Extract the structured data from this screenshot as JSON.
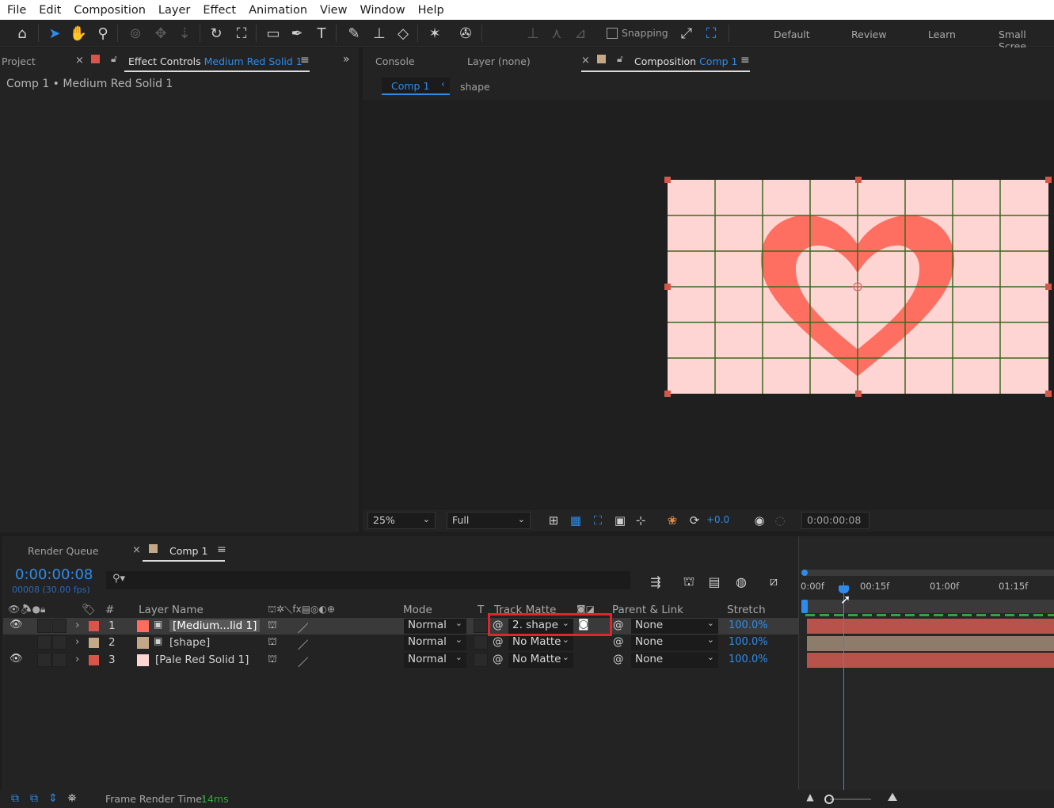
{
  "menu": [
    "File",
    "Edit",
    "Composition",
    "Layer",
    "Effect",
    "Animation",
    "View",
    "Window",
    "Help"
  ],
  "toolbar": {
    "snapping_label": "Snapping",
    "workspaces": [
      "Default",
      "Review",
      "Learn",
      "Small Scree"
    ]
  },
  "left_panel": {
    "project_tab": "Project",
    "effect_controls_label": "Effect Controls",
    "effect_controls_target": "Medium Red Solid 1",
    "breadcrumb": "Comp 1 • Medium Red Solid 1"
  },
  "comp_panel": {
    "console_tab": "Console",
    "layer_tab": "Layer (none)",
    "composition_label": "Composition",
    "composition_name": "Comp 1",
    "nav_comp": "Comp 1",
    "nav_layer": "shape",
    "zoom": "25%",
    "resolution": "Full",
    "exposure": "+0.0",
    "timecode": "0:00:00:08"
  },
  "timeline": {
    "render_queue_tab": "Render Queue",
    "comp_tab": "Comp 1",
    "current_time": "0:00:00:08",
    "frame_info": "00008 (30.00 fps)",
    "columns": {
      "num": "#",
      "layer_name": "Layer Name",
      "mode": "Mode",
      "t": "T",
      "track_matte": "Track Matte",
      "parent_link": "Parent & Link",
      "stretch": "Stretch"
    },
    "ruler": [
      "0:00f",
      "00:15f",
      "01:00f",
      "01:15f"
    ],
    "layers": [
      {
        "num": "1",
        "name": "[Medium...lid 1]",
        "label_color": "#d9554a",
        "swatch": "#ff6b5e",
        "mode": "Normal",
        "matte": "2. shape",
        "parent": "None",
        "stretch": "100.0%",
        "visible": true,
        "bar_color": "#b8534b"
      },
      {
        "num": "2",
        "name": "[shape]",
        "label_color": "#c4a787",
        "swatch": "#c4a787",
        "mode": "Normal",
        "matte": "No Matte",
        "parent": "None",
        "stretch": "100.0%",
        "visible": false,
        "bar_color": "#8e7c6a"
      },
      {
        "num": "3",
        "name": "[Pale Red Solid 1]",
        "label_color": "#d9554a",
        "swatch": "#ffd5d3",
        "mode": "Normal",
        "matte": "No Matte",
        "parent": "None",
        "stretch": "100.0%",
        "visible": true,
        "bar_color": "#b8534b"
      }
    ]
  },
  "status": {
    "frame_render_label": "Frame Render Time:",
    "frame_render_value": "14ms"
  },
  "colors": {
    "accent": "#2d8ceb",
    "highlight_box": "#e0262b",
    "heart": "#ff6f61",
    "canvas_bg": "#ffd5d3",
    "grid": "#3c6a1e"
  }
}
